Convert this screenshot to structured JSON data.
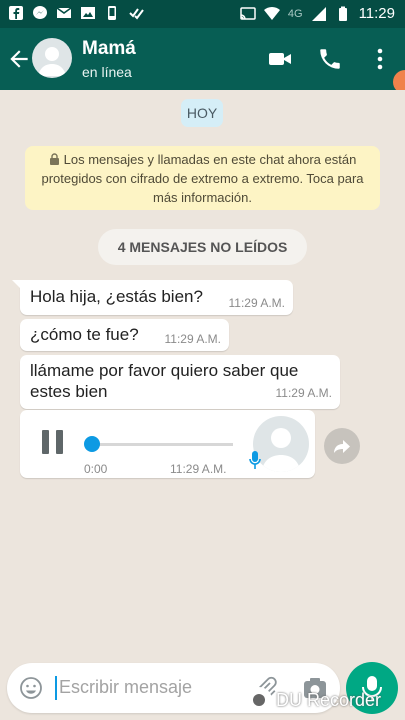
{
  "status_bar": {
    "network": "4G",
    "time": "11:29"
  },
  "header": {
    "contact_name": "Mamá",
    "contact_status": "en línea"
  },
  "chat": {
    "date_chip": "HOY",
    "encryption_notice": "Los mensajes y llamadas en este chat ahora están protegidos con cifrado de extremo a extremo. Toca para más información.",
    "unread_banner": "4 MENSAJES NO LEÍDOS",
    "messages": [
      {
        "text": "Hola hija, ¿estás bien?",
        "time": "11:29 A.M."
      },
      {
        "text": "¿cómo te fue?",
        "time": "11:29 A.M."
      },
      {
        "text": "llámame por favor quiero saber que estes bien",
        "time": "11:29 A.M."
      }
    ],
    "voice_note": {
      "duration": "0:00",
      "time": "11:29 A.M.",
      "progress": 0
    }
  },
  "composer": {
    "placeholder": "Escribir mensaje"
  },
  "watermark": "DU Recorder",
  "colors": {
    "header": "#075e54",
    "statusbar": "#054d44",
    "accent": "#00a884",
    "progress": "#0d9ae3"
  }
}
